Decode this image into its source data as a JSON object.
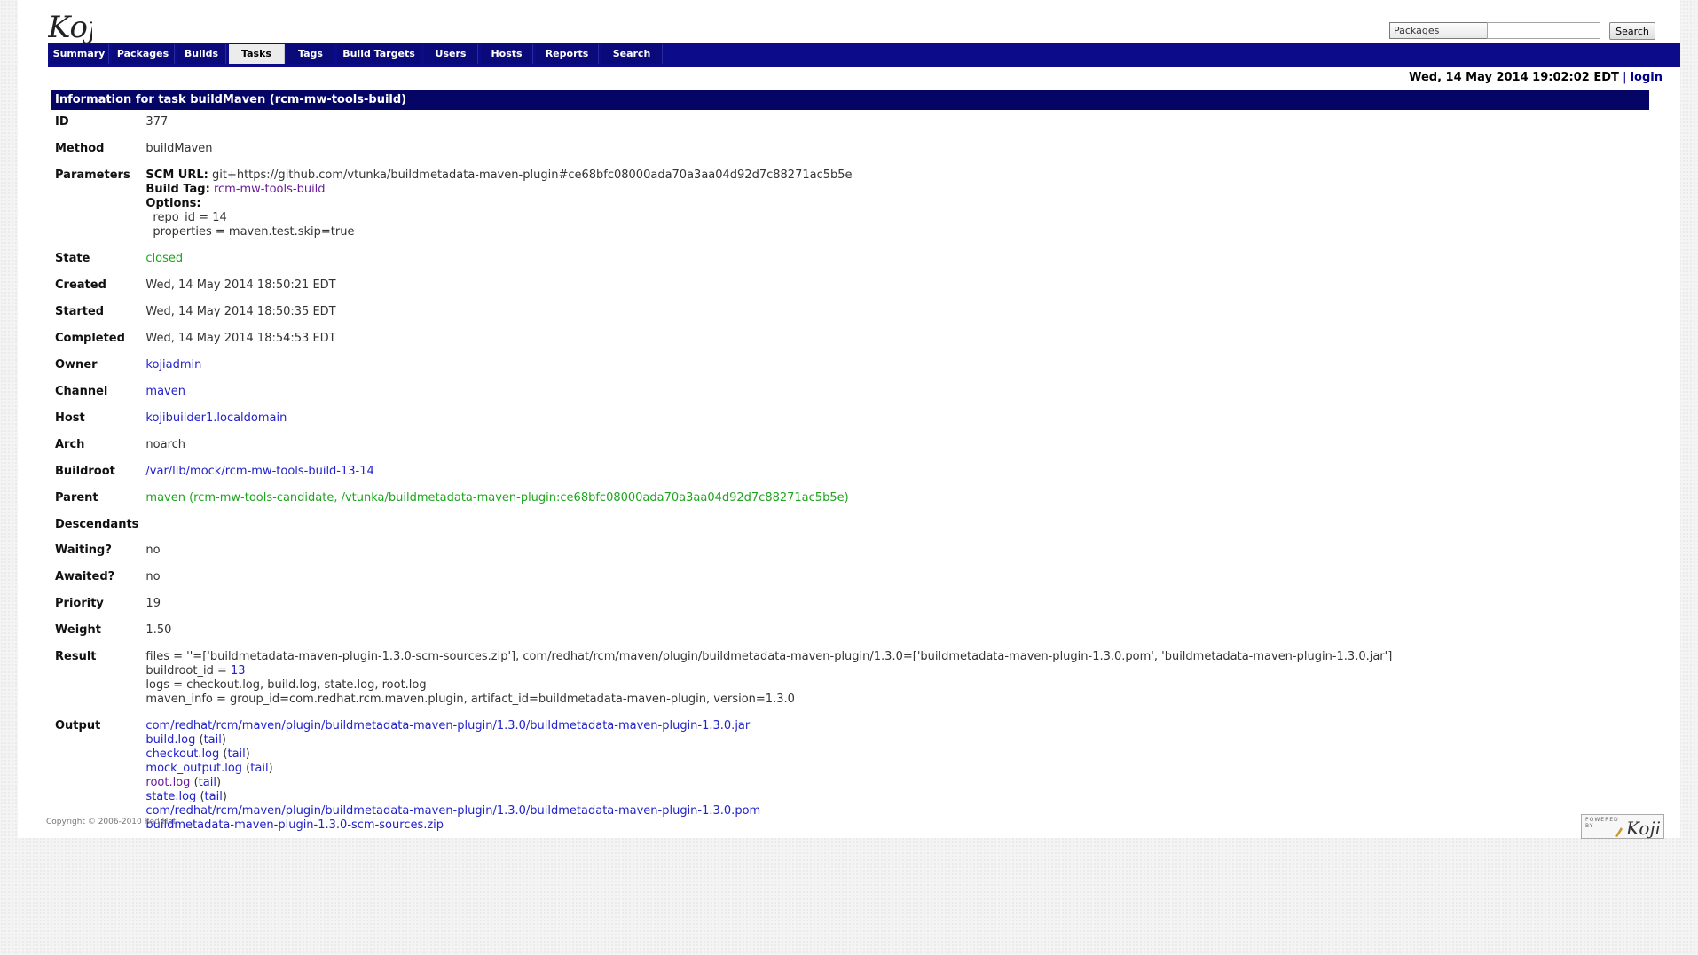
{
  "header": {
    "logo_text": "Koji",
    "search_type": "Packages",
    "search_value": "",
    "search_button": "Search"
  },
  "tabs": [
    {
      "label": "Summary",
      "active": false
    },
    {
      "label": "Packages",
      "active": false
    },
    {
      "label": "Builds",
      "active": false
    },
    {
      "label": "Tasks",
      "active": true
    },
    {
      "label": "Tags",
      "active": false
    },
    {
      "label": "Build Targets",
      "active": false
    },
    {
      "label": "Users",
      "active": false
    },
    {
      "label": "Hosts",
      "active": false
    },
    {
      "label": "Reports",
      "active": false
    },
    {
      "label": "Search",
      "active": false
    }
  ],
  "datebar": {
    "date": "Wed, 14 May 2014 19:02:02 EDT",
    "separator": "|",
    "login": "login"
  },
  "title": "Information for task buildMaven (rcm-mw-tools-build)",
  "task": {
    "id_label": "ID",
    "id": "377",
    "method_label": "Method",
    "method": "buildMaven",
    "parameters_label": "Parameters",
    "scm_url_label": "SCM URL:",
    "scm_url": "git+https://github.com/vtunka/buildmetadata-maven-plugin#ce68bfc08000ada70a3aa04d92d7c88271ac5b5e",
    "build_tag_label": "Build Tag:",
    "build_tag": "rcm-mw-tools-build",
    "options_label": "Options:",
    "option_repo_id": "repo_id = 14",
    "option_properties": "properties = maven.test.skip=true",
    "state_label": "State",
    "state": "closed",
    "created_label": "Created",
    "created": "Wed, 14 May 2014 18:50:21 EDT",
    "started_label": "Started",
    "started": "Wed, 14 May 2014 18:50:35 EDT",
    "completed_label": "Completed",
    "completed": "Wed, 14 May 2014 18:54:53 EDT",
    "owner_label": "Owner",
    "owner": "kojiadmin",
    "channel_label": "Channel",
    "channel": "maven",
    "host_label": "Host",
    "host": "kojibuilder1.localdomain",
    "arch_label": "Arch",
    "arch": "noarch",
    "buildroot_label": "Buildroot",
    "buildroot": "/var/lib/mock/rcm-mw-tools-build-13-14",
    "parent_label": "Parent",
    "parent": "maven (rcm-mw-tools-candidate, /vtunka/buildmetadata-maven-plugin:ce68bfc08000ada70a3aa04d92d7c88271ac5b5e)",
    "descendants_label": "Descendants",
    "waiting_label": "Waiting?",
    "waiting": "no",
    "awaited_label": "Awaited?",
    "awaited": "no",
    "priority_label": "Priority",
    "priority": "19",
    "weight_label": "Weight",
    "weight": "1.50",
    "result_label": "Result",
    "result_files": "files = ''=['buildmetadata-maven-plugin-1.3.0-scm-sources.zip'], com/redhat/rcm/maven/plugin/buildmetadata-maven-plugin/1.3.0=['buildmetadata-maven-plugin-1.3.0.pom', 'buildmetadata-maven-plugin-1.3.0.jar']",
    "result_buildroot_prefix": "buildroot_id = ",
    "result_buildroot_id": "13",
    "result_logs": "logs = checkout.log, build.log, state.log, root.log",
    "result_maven_info": "maven_info = group_id=com.redhat.rcm.maven.plugin, artifact_id=buildmetadata-maven-plugin, version=1.3.0",
    "output_label": "Output",
    "outputs": [
      {
        "name": "com/redhat/rcm/maven/plugin/buildmetadata-maven-plugin/1.3.0/buildmetadata-maven-plugin-1.3.0.jar",
        "tail": ""
      },
      {
        "name": "build.log",
        "tail": "tail"
      },
      {
        "name": "checkout.log",
        "tail": "tail"
      },
      {
        "name": "mock_output.log",
        "tail": "tail"
      },
      {
        "name": "root.log",
        "tail": "tail"
      },
      {
        "name": "state.log",
        "tail": "tail"
      },
      {
        "name": "com/redhat/rcm/maven/plugin/buildmetadata-maven-plugin/1.3.0/buildmetadata-maven-plugin-1.3.0.pom",
        "tail": ""
      },
      {
        "name": "buildmetadata-maven-plugin-1.3.0-scm-sources.zip",
        "tail": ""
      }
    ]
  },
  "footer": {
    "copyright": "Copyright © 2006-2010 Red Hat",
    "powered_by": "POWERED BY",
    "powered_logo": "Koji"
  },
  "colors": {
    "nav_bg": "#0c0c8a",
    "title_bg": "#050566",
    "link": "#2222cc",
    "state_closed": "#1ea51e"
  }
}
